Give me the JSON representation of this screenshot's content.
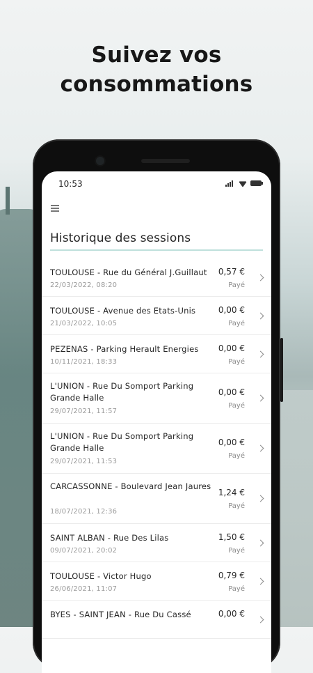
{
  "promo": {
    "headline_line1": "Suivez vos",
    "headline_line2": "consommations"
  },
  "status_bar": {
    "time": "10:53"
  },
  "screen": {
    "title": "Historique des sessions"
  },
  "sessions": [
    {
      "address": "TOULOUSE - Rue du Général J.Guillaut",
      "date": "22/03/2022, 08:20",
      "amount": "0,57 €",
      "status": "Payé"
    },
    {
      "address": "TOULOUSE - Avenue des Etats-Unis",
      "date": "21/03/2022, 10:05",
      "amount": "0,00 €",
      "status": "Payé"
    },
    {
      "address": "PEZENAS - Parking Herault Energies",
      "date": "10/11/2021, 18:33",
      "amount": "0,00 €",
      "status": "Payé"
    },
    {
      "address": "L'UNION - Rue Du Somport Parking Grande Halle",
      "date": "29/07/2021, 11:57",
      "amount": "0,00 €",
      "status": "Payé"
    },
    {
      "address": "L'UNION - Rue Du Somport Parking Grande Halle",
      "date": "29/07/2021, 11:53",
      "amount": "0,00 €",
      "status": "Payé"
    },
    {
      "address": "CARCASSONNE - Boulevard Jean Jaures",
      "date": "18/07/2021, 12:36",
      "amount": "1,24 €",
      "status": "Payé"
    },
    {
      "address": "SAINT ALBAN - Rue Des Lilas",
      "date": "09/07/2021, 20:02",
      "amount": "1,50 €",
      "status": "Payé"
    },
    {
      "address": "TOULOUSE - Victor Hugo",
      "date": "26/06/2021, 11:07",
      "amount": "0,79 €",
      "status": "Payé"
    },
    {
      "address": "BYES - SAINT JEAN - Rue Du Cassé",
      "date": "",
      "amount": "0,00 €",
      "status": ""
    }
  ],
  "icons": {
    "menu": "hamburger-icon",
    "row_arrow": "chevron-right-icon",
    "signal": "signal-icon",
    "wifi": "wifi-icon",
    "battery": "battery-icon"
  }
}
